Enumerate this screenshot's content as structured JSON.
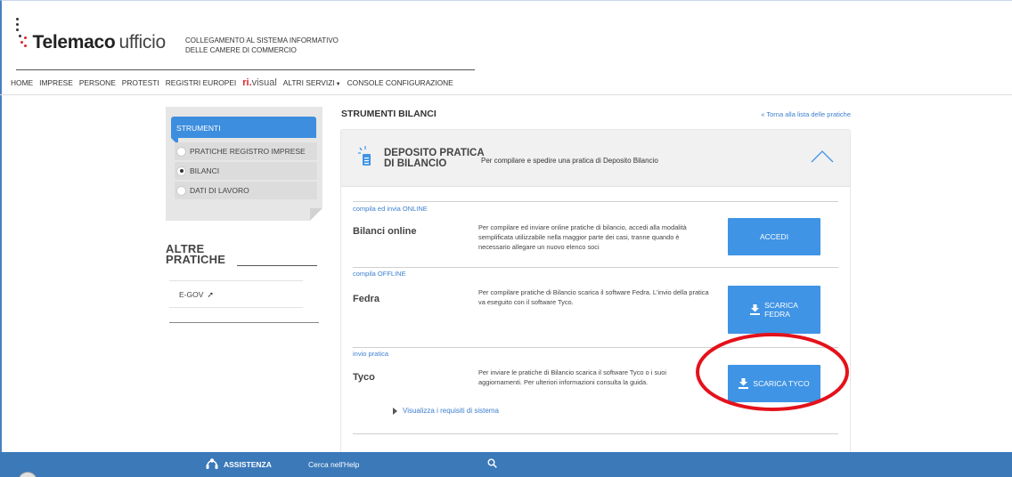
{
  "header": {
    "brand_name": "Telemaco",
    "brand_suffix": "ufficio",
    "subtitle_line1": "COLLEGAMENTO AL SISTEMA INFORMATIVO",
    "subtitle_line2": "DELLE CAMERE DI COMMERCIO"
  },
  "menu": {
    "items": [
      "HOME",
      "IMPRESE",
      "PERSONE",
      "PROTESTI",
      "REGISTRI EUROPEI"
    ],
    "rivisual_prefix": "ri.",
    "rivisual_suffix": "visual",
    "altri_servizi": "ALTRI SERVIZI",
    "console": "CONSOLE CONFIGURAZIONE"
  },
  "sidebar": {
    "tools_title": "STRUMENTI",
    "tools": [
      {
        "label": "PRATICHE REGISTRO IMPRESE",
        "selected": false
      },
      {
        "label": "BILANCI",
        "selected": true
      },
      {
        "label": "DATI DI LAVORO",
        "selected": false
      }
    ],
    "altre_line1": "ALTRE",
    "altre_line2": "PRATICHE",
    "egov_label": "E-GOV"
  },
  "main": {
    "title": "STRUMENTI BILANCI",
    "back_link": "« Torna alla lista delle pratiche",
    "deposito_line1": "DEPOSITO PRATICA",
    "deposito_line2": "DI BILANCIO",
    "deposito_desc": "Per compilare e spedire una pratica di Deposito Bilancio",
    "sections": [
      {
        "label": "compila ed invia ONLINE",
        "name": "Bilanci online",
        "text": "Per compilare ed inviare online pratiche di bilancio, accedi alla modalità semplificata utilizzabile nella maggior parte dei casi, tranne quando è necessario allegare un nuovo elenco soci",
        "button": "ACCEDI"
      },
      {
        "label": "compila OFFLINE",
        "name": "Fedra",
        "text": "Per compilare pratiche di Bilancio scarica il software Fedra. L'invio della pratica va eseguito con il software Tyco.",
        "button_line1": "SCARICA",
        "button_line2": "FEDRA"
      },
      {
        "label": "invio pratica",
        "name": "Tyco",
        "text": "Per inviare le pratiche di Bilancio scarica il software Tyco o i suoi aggiornamenti. Per ulteriori informazioni consulta la guida.",
        "button": "SCARICA TYCO"
      }
    ],
    "requirements_link": "Visualizza i requisiti di sistema"
  },
  "footer": {
    "assistenza": "ASSISTENZA",
    "help": "Cerca nell'Help"
  },
  "colors": {
    "accent": "#3f94e5",
    "brand_red": "#e0242a",
    "footer_bg": "#3b79b9",
    "annotation": "#e3121b"
  }
}
